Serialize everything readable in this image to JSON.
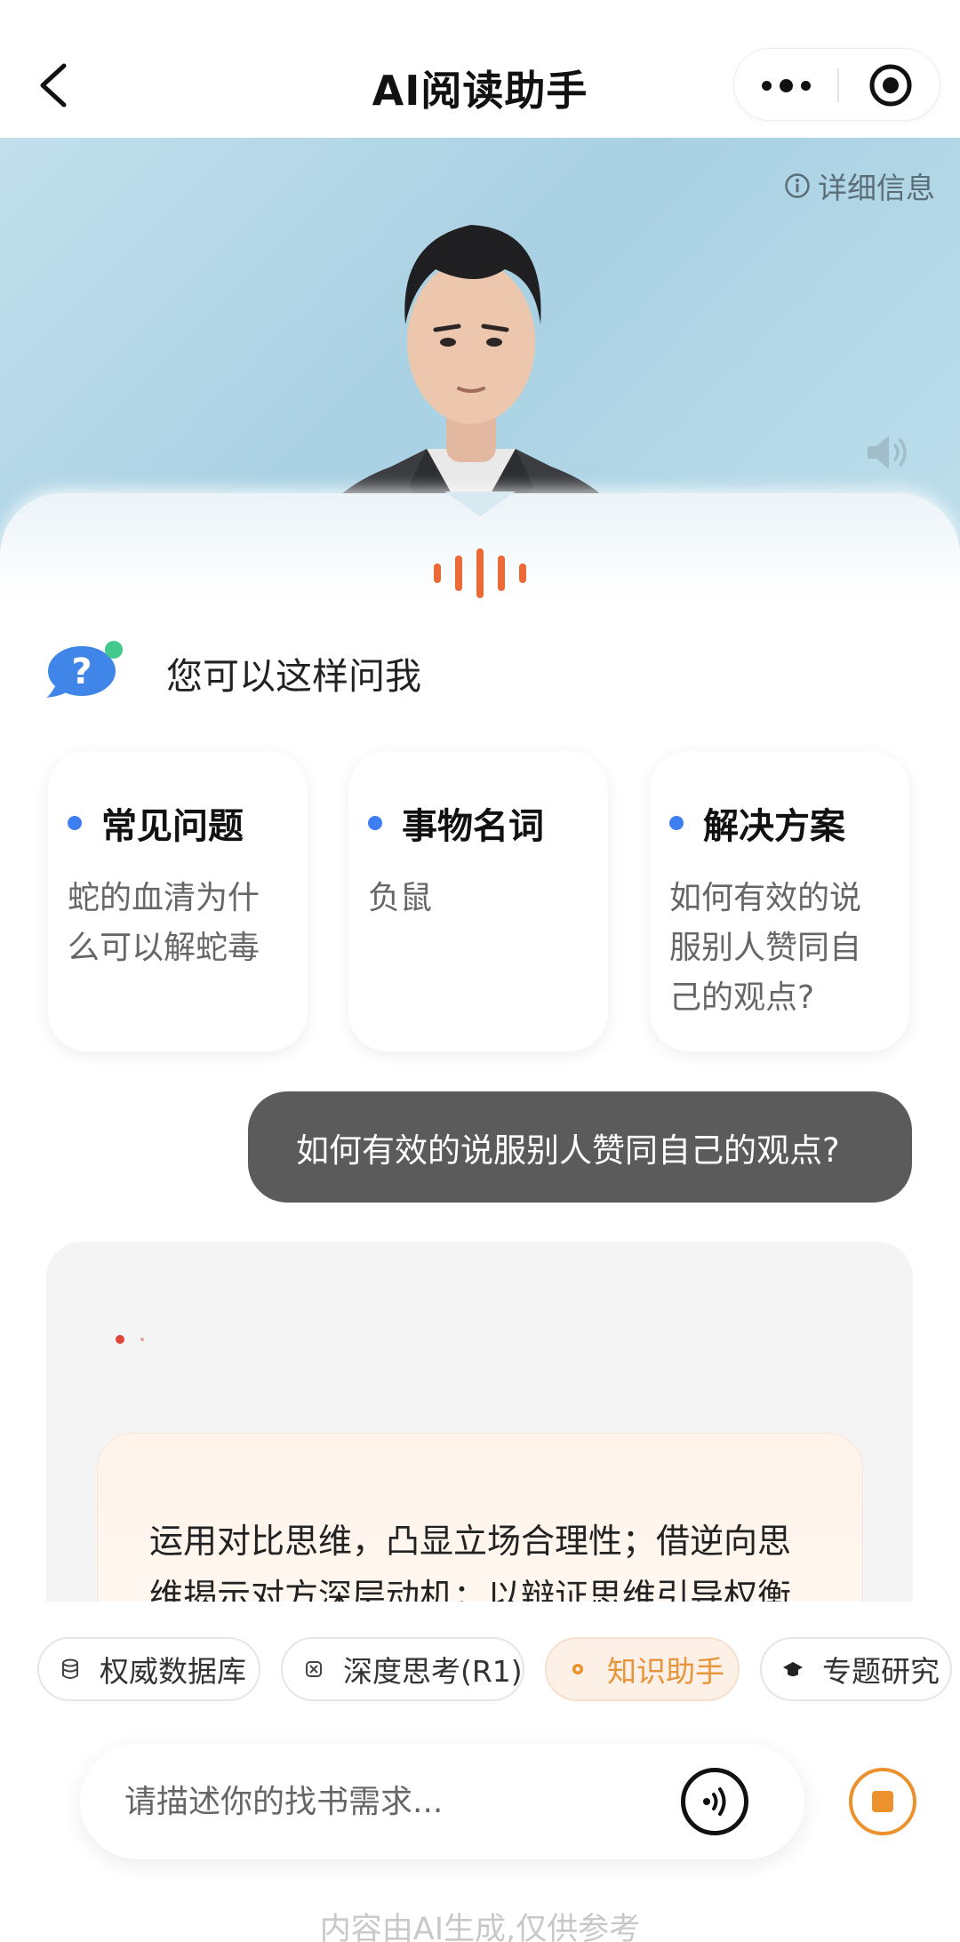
{
  "header": {
    "title": "AI阅读助手"
  },
  "hero": {
    "detail_info_label": "详细信息"
  },
  "prompts": {
    "heading": "您可以这样问我",
    "cards": [
      {
        "title": "常见问题",
        "body": "蛇的血清为什么可以解蛇毒"
      },
      {
        "title": "事物名词",
        "body": "负鼠"
      },
      {
        "title": "解决方案",
        "body": "如何有效的说服别人赞同自己的观点?"
      }
    ]
  },
  "chat": {
    "user_message": "如何有效的说服别人赞同自己的观点?",
    "answer_text": "运用对比思维，凸显立场合理性；借逆向思维揭示对方深层动机；以辩证思维引导权衡"
  },
  "toolbar": {
    "chips": [
      {
        "label": "权威数据库",
        "icon": "database-icon",
        "active": false
      },
      {
        "label": "深度思考(R1)",
        "icon": "deep-think-icon",
        "active": false
      },
      {
        "label": "知识助手",
        "icon": "knowledge-icon",
        "active": true
      },
      {
        "label": "专题研究",
        "icon": "graduation-cap-icon",
        "active": false
      }
    ]
  },
  "input": {
    "placeholder": "请描述你的找书需求..."
  },
  "footer": {
    "disclaimer": "内容由AI生成,仅供参考"
  },
  "colors": {
    "accent_orange": "#EC6A36",
    "accent_blue": "#3D7FF2",
    "user_bubble": "#5B5B5B",
    "stop_orange": "#EB922E"
  }
}
